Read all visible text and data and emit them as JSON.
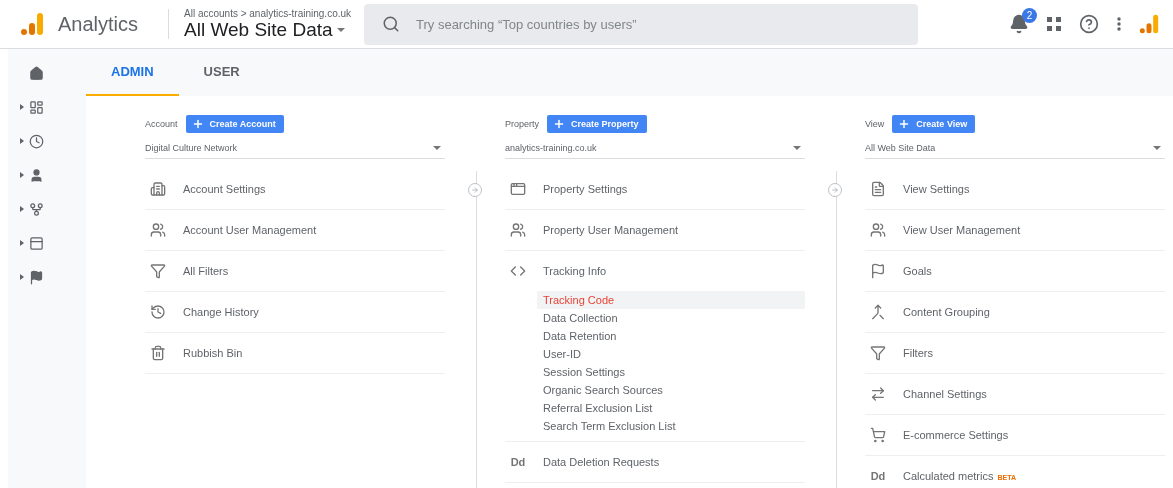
{
  "header": {
    "product": "Analytics",
    "breadcrumb": "All accounts > analytics-training.co.uk",
    "view_name": "All Web Site Data",
    "search": {
      "placeholder": "Try searching “Top countries by users”"
    },
    "notifications": "2"
  },
  "tabs": [
    {
      "label": "ADMIN",
      "selected": true
    },
    {
      "label": "USER",
      "selected": false
    }
  ],
  "columns": [
    {
      "label": "Account",
      "create": "Create Account",
      "selector": "Digital Culture Network",
      "items": [
        {
          "label": "Account Settings"
        },
        {
          "label": "Account User Management"
        },
        {
          "label": "All Filters"
        },
        {
          "label": "Change History"
        },
        {
          "label": "Rubbish Bin"
        }
      ]
    },
    {
      "label": "Property",
      "create": "Create Property",
      "selector": "analytics-training.co.uk",
      "items": [
        {
          "label": "Property Settings"
        },
        {
          "label": "Property User Management"
        },
        {
          "label": "Tracking Info",
          "children": [
            {
              "label": "Tracking Code",
              "selected": true
            },
            {
              "label": "Data Collection",
              "selected": false
            },
            {
              "label": "Data Retention",
              "selected": false
            },
            {
              "label": "User-ID",
              "selected": false
            },
            {
              "label": "Session Settings",
              "selected": false
            },
            {
              "label": "Organic Search Sources",
              "selected": false
            },
            {
              "label": "Referral Exclusion List",
              "selected": false
            },
            {
              "label": "Search Term Exclusion List",
              "selected": false
            }
          ]
        },
        {
          "icon_text": "Dd",
          "label": "Data Deletion Requests"
        }
      ]
    },
    {
      "label": "View",
      "create": "Create View",
      "selector": "All Web Site Data",
      "items": [
        {
          "label": "View Settings"
        },
        {
          "label": "View User Management"
        },
        {
          "label": "Goals"
        },
        {
          "label": "Content Grouping"
        },
        {
          "label": "Filters"
        },
        {
          "label": "Channel Settings"
        },
        {
          "label": "E-commerce Settings"
        },
        {
          "icon_text": "Dd",
          "label": "Calculated metrics",
          "badge": "BETA"
        }
      ]
    }
  ]
}
